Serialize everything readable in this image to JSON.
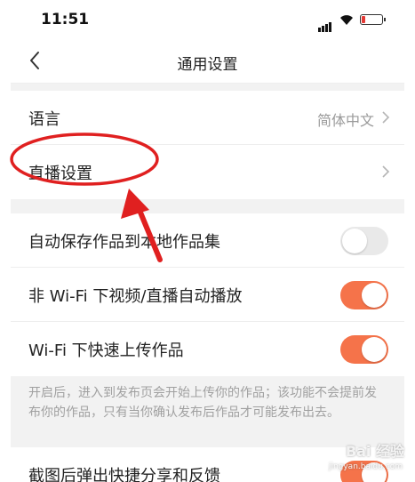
{
  "status_bar": {
    "time": "11:51",
    "battery_color": "#e53935"
  },
  "nav": {
    "title": "通用设置",
    "back_icon": "chevron-left-icon"
  },
  "group1": {
    "language": {
      "label": "语言",
      "value": "简体中文"
    },
    "live": {
      "label": "直播设置"
    }
  },
  "group2": {
    "items": [
      {
        "label": "自动保存作品到本地作品集",
        "state": "off"
      },
      {
        "label": "非 Wi-Fi 下视频/直播自动播放",
        "state": "on"
      },
      {
        "label": "Wi-Fi 下快速上传作品",
        "state": "on"
      }
    ],
    "note": "开启后，进入到发布页会开始上传你的作品；该功能不会提前发布你的作品，只有当你确认发布后作品才可能发布出去。"
  },
  "group3": {
    "items": [
      {
        "label": "截图后弹出快捷分享和反馈",
        "state": "on"
      }
    ]
  },
  "colors": {
    "accent": "#f5734a",
    "annotation": "#e02020"
  },
  "watermark": {
    "text": "Bai 经验",
    "sub": "jingyan.baidu.com"
  }
}
